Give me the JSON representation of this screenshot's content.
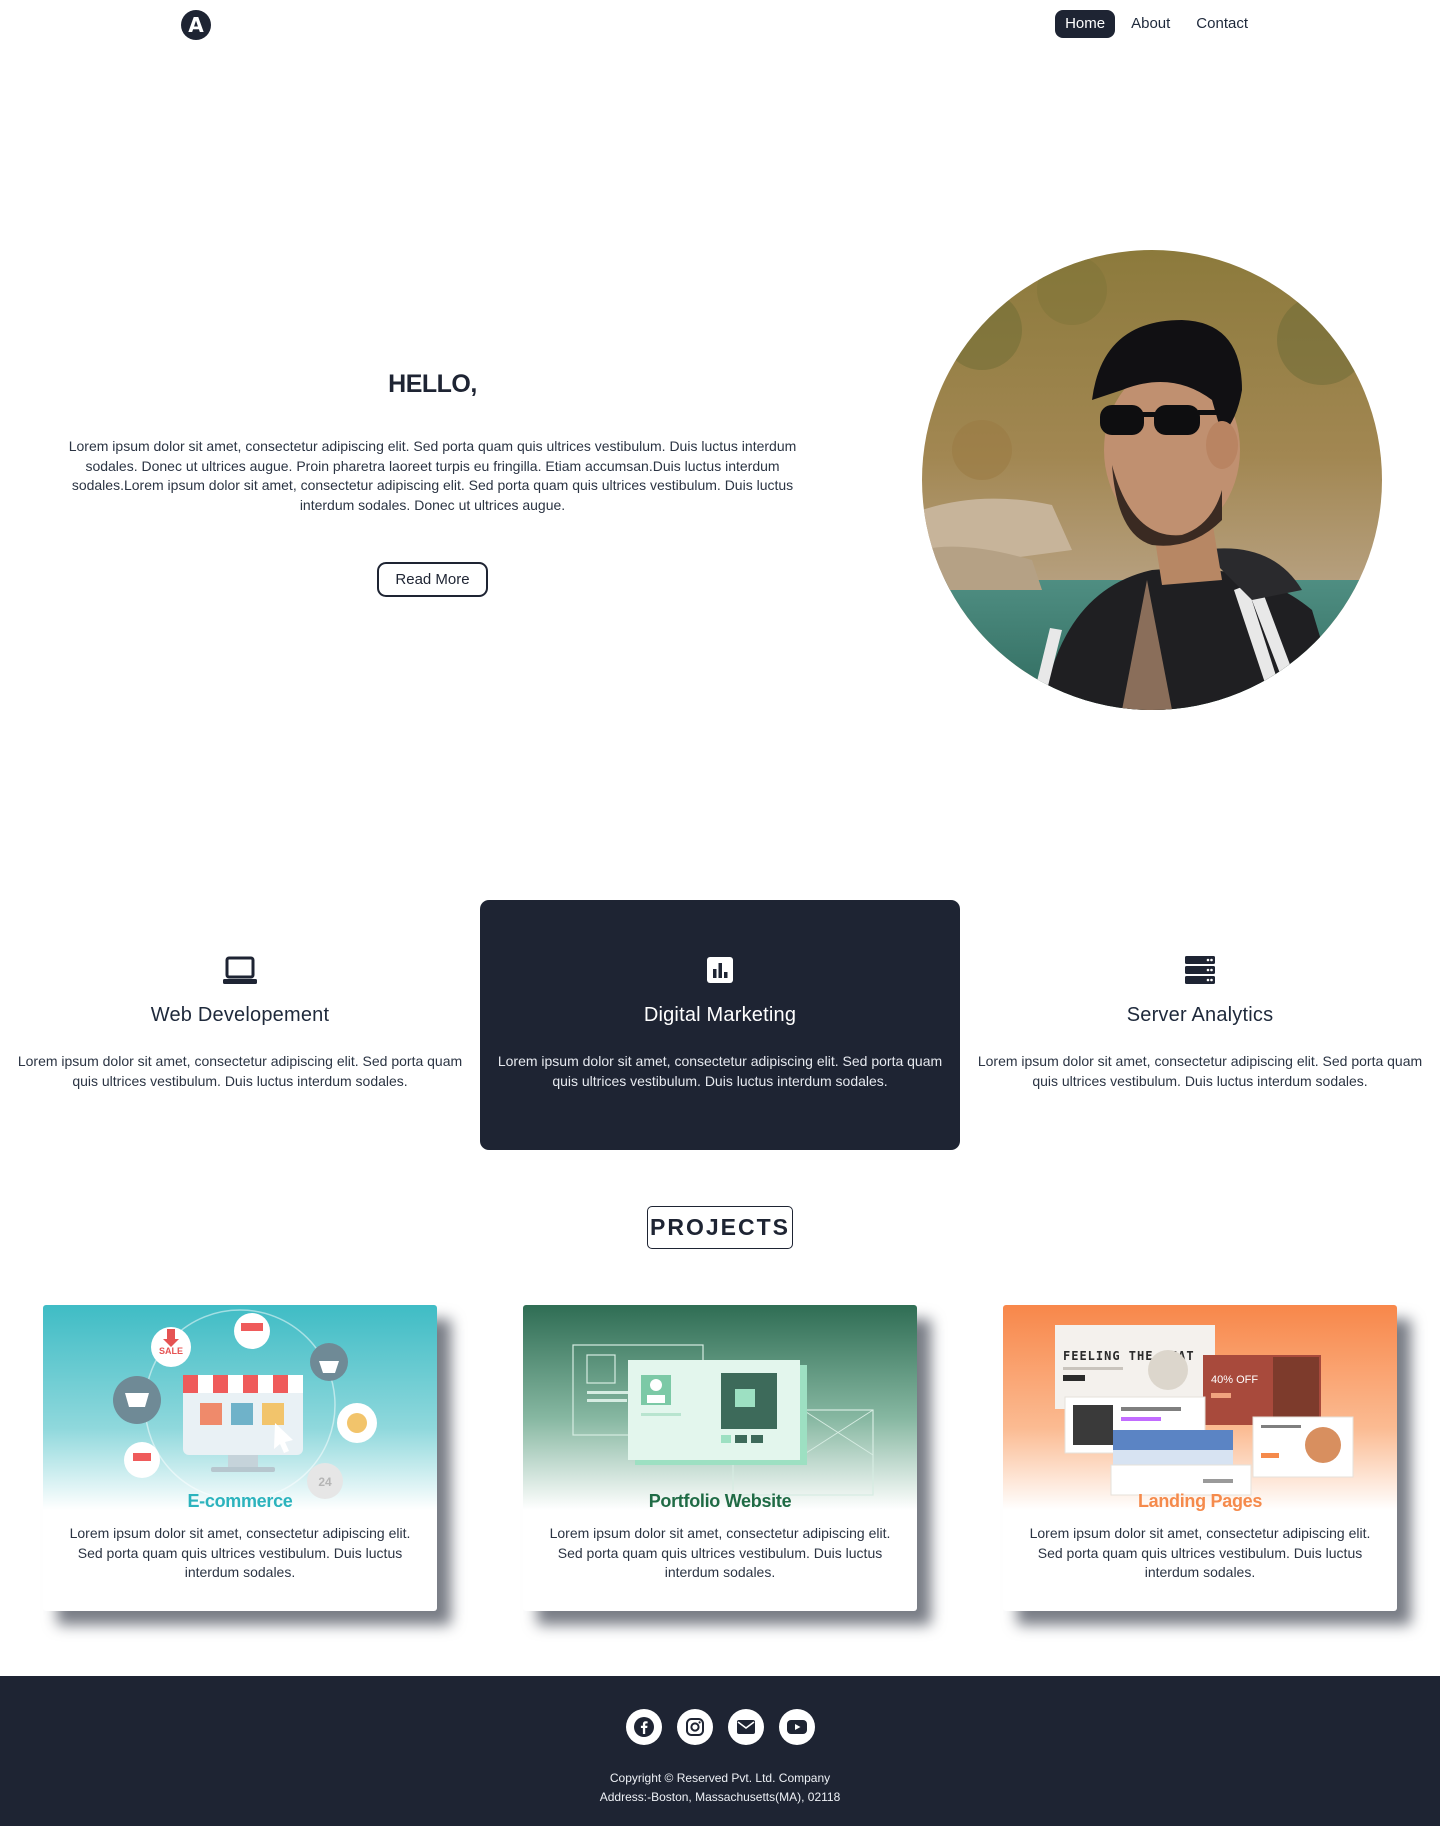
{
  "nav": {
    "logo_letter": "A",
    "links": [
      {
        "label": "Home",
        "active": true
      },
      {
        "label": "About",
        "active": false
      },
      {
        "label": "Contact",
        "active": false
      }
    ]
  },
  "hero": {
    "title": "HELLO,",
    "body": "Lorem ipsum dolor sit amet, consectetur adipiscing elit. Sed porta quam quis ultrices vestibulum. Duis luctus interdum sodales. Donec ut ultrices augue. Proin pharetra laoreet turpis eu fringilla. Etiam accumsan.Duis luctus interdum sodales.Lorem ipsum dolor sit amet, consectetur adipiscing elit. Sed porta quam quis ultrices vestibulum. Duis luctus interdum sodales. Donec ut ultrices augue.",
    "button": "Read More"
  },
  "services": [
    {
      "icon": "laptop-icon",
      "title": "Web Developement",
      "body": "Lorem ipsum dolor sit amet, consectetur adipiscing elit. Sed porta quam quis ultrices vestibulum. Duis luctus interdum sodales."
    },
    {
      "icon": "chart-icon",
      "title": "Digital Marketing",
      "body": "Lorem ipsum dolor sit amet, consectetur adipiscing elit. Sed porta quam quis ultrices vestibulum. Duis luctus interdum sodales."
    },
    {
      "icon": "server-icon",
      "title": "Server Analytics",
      "body": "Lorem ipsum dolor sit amet, consectetur adipiscing elit. Sed porta quam quis ultrices vestibulum. Duis luctus interdum sodales."
    }
  ],
  "projects": {
    "heading": "PROJECTS",
    "cards": [
      {
        "title": "E-commerce",
        "title_color": "#2bb3bd",
        "body": "Lorem ipsum dolor sit amet, consectetur adipiscing elit. Sed porta quam quis ultrices vestibulum. Duis luctus interdum sodales.",
        "thumb_sale": "SALE",
        "thumb_hours": "24"
      },
      {
        "title": "Portfolio Website",
        "title_color": "#1f6b45",
        "body": "Lorem ipsum dolor sit amet, consectetur adipiscing elit. Sed porta quam quis ultrices vestibulum. Duis luctus interdum sodales."
      },
      {
        "title": "Landing Pages",
        "title_color": "#f58a4b",
        "body": "Lorem ipsum dolor sit amet, consectetur adipiscing elit. Sed porta quam quis ultrices vestibulum. Duis luctus interdum sodales.",
        "thumb_headline": "FEELING THE BEAT",
        "thumb_offer": "40% OFF"
      }
    ]
  },
  "footer": {
    "socials": [
      "facebook-icon",
      "instagram-icon",
      "envelope-icon",
      "youtube-icon"
    ],
    "copyright": "Copyright © Reserved Pvt. Ltd. Company",
    "address": "Address:-Boston, Massachusetts(MA), 02118"
  },
  "colors": {
    "primary_dark": "#1e2433",
    "ecommerce_teal": "#2bb3bd",
    "portfolio_green": "#1f6b45",
    "landing_orange": "#f58a4b"
  }
}
